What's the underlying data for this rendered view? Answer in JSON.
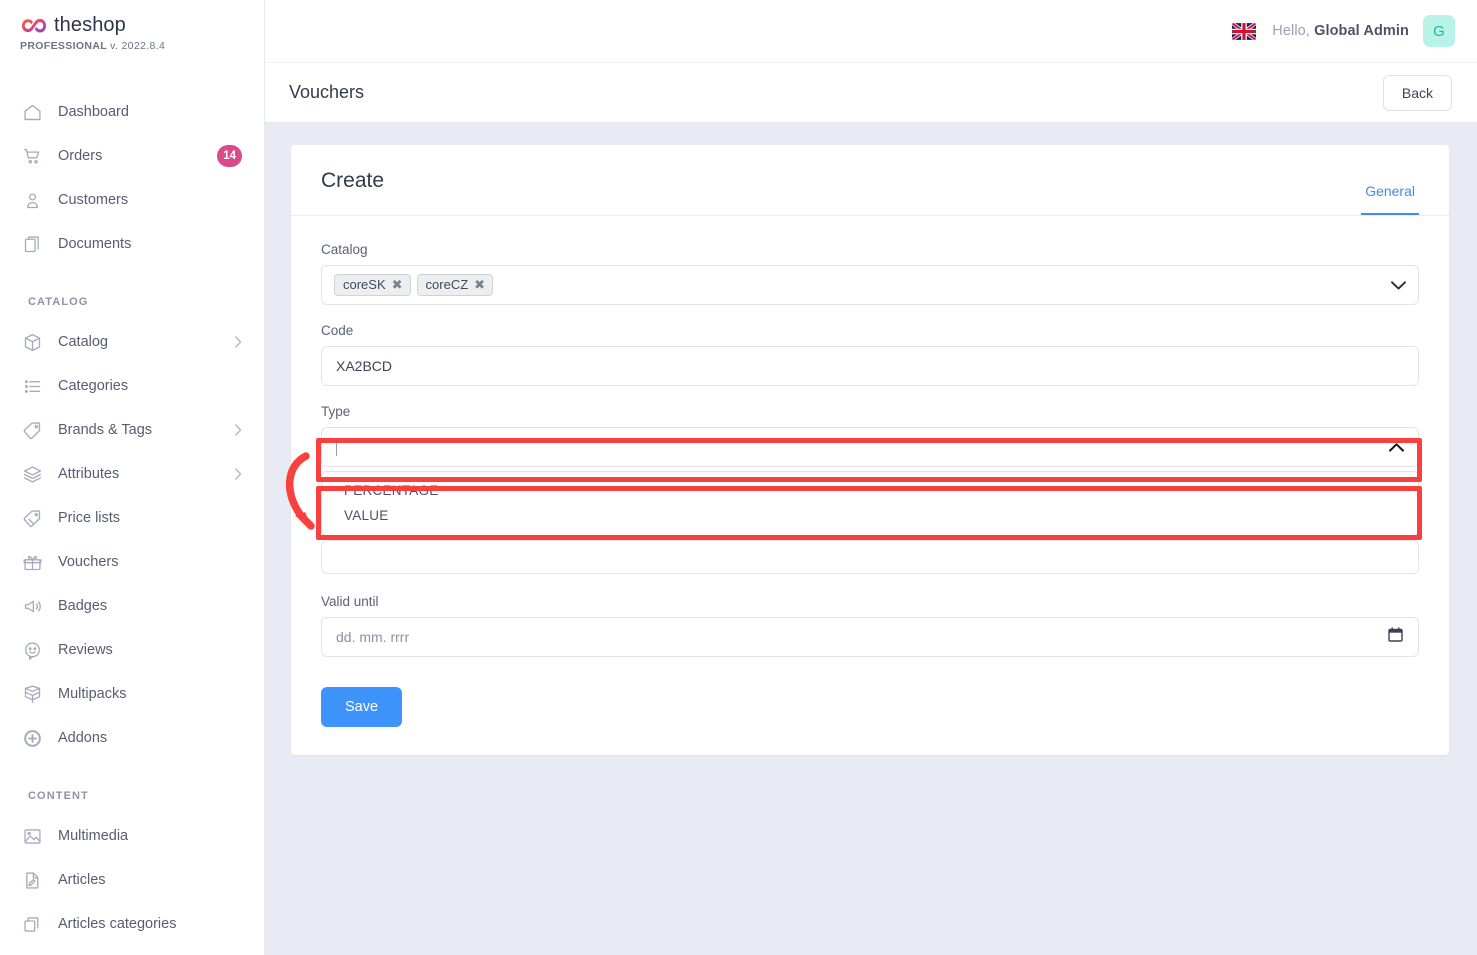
{
  "brand": {
    "name": "theshop",
    "edition": "PROFESSIONAL",
    "version": "v. 2022.8.4",
    "logo_colors": [
      "#f05a3e",
      "#e0427f",
      "#7a4bd6"
    ]
  },
  "topbar": {
    "language_icon": "uk-flag-icon",
    "greeting_prefix": "Hello,",
    "user_name": "Global Admin",
    "avatar_initial": "G",
    "avatar_bg": "#b9f2e6",
    "avatar_fg": "#17b9b0"
  },
  "pagebar": {
    "title": "Vouchers",
    "back_label": "Back"
  },
  "sidebar": {
    "groups": [
      {
        "label": null,
        "items": [
          {
            "label": "Dashboard",
            "icon": "home-icon",
            "badge": null,
            "chevron": false
          },
          {
            "label": "Orders",
            "icon": "cart-icon",
            "badge": "14",
            "chevron": false
          },
          {
            "label": "Customers",
            "icon": "user-icon",
            "badge": null,
            "chevron": false
          },
          {
            "label": "Documents",
            "icon": "documents-icon",
            "badge": null,
            "chevron": false
          }
        ]
      },
      {
        "label": "CATALOG",
        "items": [
          {
            "label": "Catalog",
            "icon": "box-icon",
            "badge": null,
            "chevron": true
          },
          {
            "label": "Categories",
            "icon": "list-icon",
            "badge": null,
            "chevron": false
          },
          {
            "label": "Brands & Tags",
            "icon": "tag-icon",
            "badge": null,
            "chevron": true
          },
          {
            "label": "Attributes",
            "icon": "layers-icon",
            "badge": null,
            "chevron": true
          },
          {
            "label": "Price lists",
            "icon": "price-tag-icon",
            "badge": null,
            "chevron": false
          },
          {
            "label": "Vouchers",
            "icon": "gift-icon",
            "badge": null,
            "chevron": false
          },
          {
            "label": "Badges",
            "icon": "megaphone-icon",
            "badge": null,
            "chevron": false
          },
          {
            "label": "Reviews",
            "icon": "smiley-chat-icon",
            "badge": null,
            "chevron": false
          },
          {
            "label": "Multipacks",
            "icon": "open-box-icon",
            "badge": null,
            "chevron": false
          },
          {
            "label": "Addons",
            "icon": "plus-circle-icon",
            "badge": null,
            "chevron": false
          }
        ]
      },
      {
        "label": "CONTENT",
        "items": [
          {
            "label": "Multimedia",
            "icon": "image-icon",
            "badge": null,
            "chevron": false
          },
          {
            "label": "Articles",
            "icon": "pencil-page-icon",
            "badge": null,
            "chevron": false
          },
          {
            "label": "Articles categories",
            "icon": "copy-icon",
            "badge": null,
            "chevron": false
          }
        ]
      }
    ],
    "badge_color": "#d84a8c"
  },
  "card": {
    "title": "Create",
    "tabs": [
      {
        "label": "General",
        "active": true
      }
    ],
    "accent_color": "#3f8cf6"
  },
  "form": {
    "catalog": {
      "label": "Catalog",
      "chips": [
        {
          "label": "coreSK",
          "remove_icon": "close-icon"
        },
        {
          "label": "coreCZ",
          "remove_icon": "close-icon"
        }
      ],
      "caret_icon": "chevron-down-icon"
    },
    "code": {
      "label": "Code",
      "value": "XA2BCD",
      "placeholder": ""
    },
    "type": {
      "label": "Type",
      "value": "",
      "placeholder": "",
      "caret_icon": "chevron-up-icon",
      "open": true,
      "options": [
        "PERCENTAGE",
        "VALUE"
      ]
    },
    "valid_until": {
      "label": "Valid until",
      "value": "",
      "placeholder": "dd. mm. rrrr",
      "icon": "calendar-icon"
    },
    "save_label": "Save",
    "save_color": "#3f94fb"
  },
  "annotation": {
    "color": "#f8413f",
    "shapes": [
      {
        "type": "rectangle",
        "target": "type-select"
      },
      {
        "type": "rectangle",
        "target": "type-options-menu"
      },
      {
        "type": "curved-arrow",
        "points_to": "type-options-menu"
      }
    ]
  }
}
